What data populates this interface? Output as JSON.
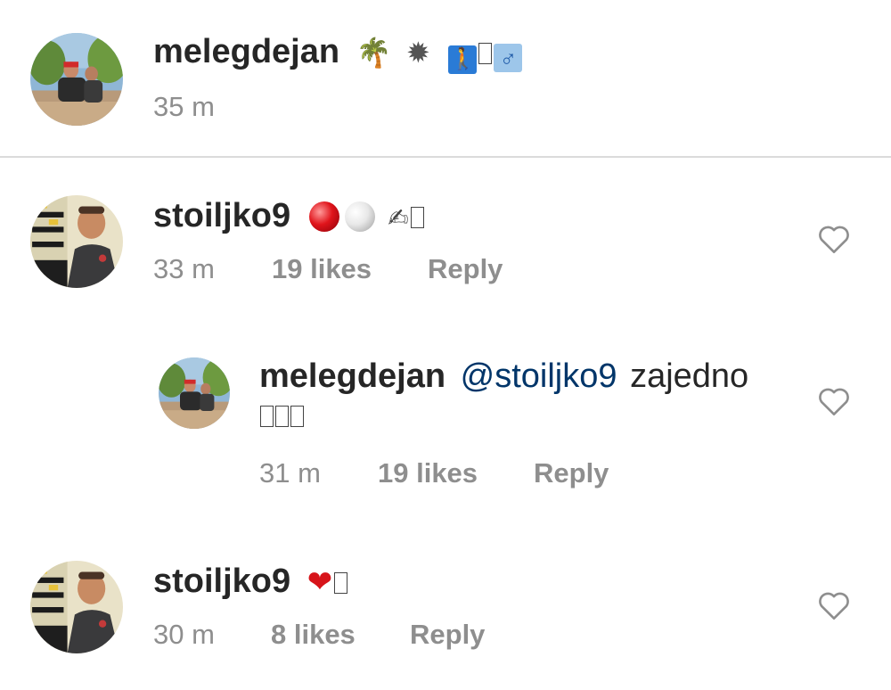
{
  "caption": {
    "username": "melegdejan",
    "emojis": [
      "🌴",
      "✹",
      "🚶",
      "♂"
    ],
    "time": "35 m"
  },
  "comments": [
    {
      "username": "stoiljko9",
      "emojis": [
        "🔴",
        "⚪",
        "✍"
      ],
      "time": "33 m",
      "likes": "19 likes",
      "reply_label": "Reply"
    },
    {
      "username": "melegdejan",
      "mention": "@stoiljko9",
      "text": "zajedno",
      "time": "31 m",
      "likes": "19 likes",
      "reply_label": "Reply"
    },
    {
      "username": "stoiljko9",
      "emojis": [
        "❤"
      ],
      "time": "30 m",
      "likes": "8 likes",
      "reply_label": "Reply"
    }
  ],
  "colors": {
    "text": "#262626",
    "secondary": "#8e8e8e",
    "mention": "#003569",
    "divider": "#dbdbdb"
  }
}
